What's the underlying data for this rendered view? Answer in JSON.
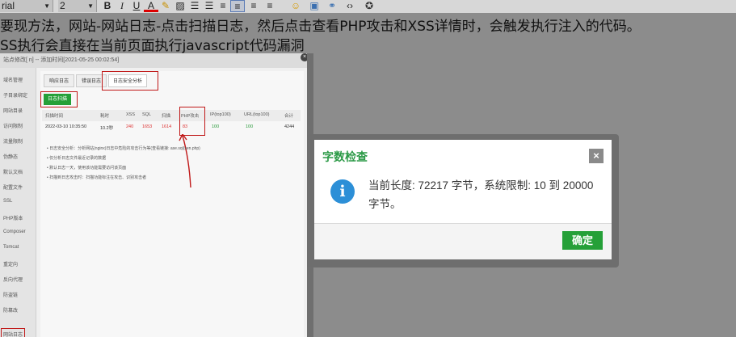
{
  "toolbar": {
    "font_family": "rial",
    "font_size": "2",
    "buttons": [
      "B",
      "I",
      "U",
      "A"
    ]
  },
  "editor": {
    "line1": "要现方法，网站-网站日志-点击扫描日志，然后点击查看PHP攻击和XSS详情时，会触发执行注入的代码。",
    "line2": "SS执行会直接在当前页面执行javascript代码漏洞"
  },
  "screenshot": {
    "title": "站点修改[                    n] -- 添加时间[2021-05-25 00:02:54]",
    "sidebar": [
      "域名管理",
      "子目录绑定",
      "网站目录",
      "访问限制",
      "流量限制",
      "伪静态",
      "默认文档",
      "配置文件",
      "SSL",
      "PHP版本",
      "Composer",
      "Tomcat",
      "重定向",
      "反向代理",
      "防盗链",
      "防篡改",
      "网站日志"
    ],
    "tabs": [
      "响应日志",
      "错误日志",
      "日志安全分析"
    ],
    "scan_button": "日志扫描",
    "table_headers": [
      "扫描时间",
      "耗时",
      "XSS",
      "SQL",
      "扫描",
      "PHP攻击",
      "IP(top100)",
      "URL(top100)",
      "合计"
    ],
    "table_row": [
      "2022-03-10 10:35:50",
      "10.2秒",
      "240",
      "1653",
      "1614",
      "83",
      "100",
      "100",
      "4244"
    ],
    "notes": [
      "• 日志安全分析：分析网站(nginx)日志中危险的攻击行为等(查看链接:  ase.sql(sen.php)",
      "• 仅分析日志文件最近记录的数据",
      "• 默认日志一天，使用该功能需要访问该页面",
      "• 扫描到日志攻击时：扫描功能标注在攻击、识别攻击者"
    ]
  },
  "dialog": {
    "title": "字数检查",
    "close": "×",
    "icon": "i",
    "message": "当前长度: 72217 字节，系统限制: 10 到 20000 字节。",
    "ok": "确定"
  },
  "colors": {
    "accent_green": "#25a038",
    "title_green": "#2c9a47",
    "info_blue": "#2c8fd7",
    "warn_red": "#c01818"
  }
}
